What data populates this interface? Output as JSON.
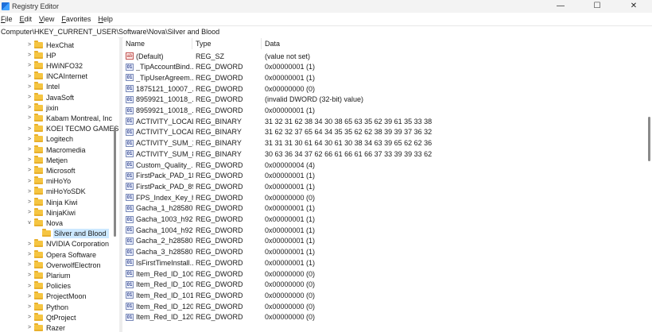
{
  "window": {
    "title": "Registry Editor",
    "controls": {
      "minimize": "—",
      "maximize": "☐",
      "close": "✕"
    }
  },
  "menu": [
    {
      "underline": "F",
      "rest": "ile"
    },
    {
      "underline": "E",
      "rest": "dit"
    },
    {
      "underline": "V",
      "rest": "iew"
    },
    {
      "underline": "F",
      "rest": "avorites"
    },
    {
      "underline": "H",
      "rest": "elp"
    }
  ],
  "address": "Computer\\HKEY_CURRENT_USER\\Software\\Nova\\Silver and Blood",
  "tree": {
    "items": [
      {
        "label": "HexChat",
        "expander": ">"
      },
      {
        "label": "HP",
        "expander": ">"
      },
      {
        "label": "HWiNFO32",
        "expander": ">"
      },
      {
        "label": "INCAInternet",
        "expander": ">"
      },
      {
        "label": "Intel",
        "expander": ">"
      },
      {
        "label": "JavaSoft",
        "expander": ">"
      },
      {
        "label": "jixin",
        "expander": ">"
      },
      {
        "label": "Kabam Montreal, Inc",
        "expander": ">"
      },
      {
        "label": "KOEI TECMO GAMES",
        "expander": ">"
      },
      {
        "label": "Logitech",
        "expander": ">"
      },
      {
        "label": "Macromedia",
        "expander": ">"
      },
      {
        "label": "Metjen",
        "expander": ">"
      },
      {
        "label": "Microsoft",
        "expander": ">"
      },
      {
        "label": "miHoYo",
        "expander": ">"
      },
      {
        "label": "miHoYoSDK",
        "expander": ">"
      },
      {
        "label": "Ninja Kiwi",
        "expander": ">"
      },
      {
        "label": "NinjaKiwi",
        "expander": ">"
      },
      {
        "label": "Nova",
        "expander": "v"
      },
      {
        "label": "Silver and Blood",
        "expander": ""
      },
      {
        "label": "NVIDIA Corporation",
        "expander": ">"
      },
      {
        "label": "Opera Software",
        "expander": ">"
      },
      {
        "label": "OverwolfElectron",
        "expander": ">"
      },
      {
        "label": "Plarium",
        "expander": ">"
      },
      {
        "label": "Policies",
        "expander": ">"
      },
      {
        "label": "ProjectMoon",
        "expander": ">"
      },
      {
        "label": "Python",
        "expander": ">"
      },
      {
        "label": "QtProject",
        "expander": ">"
      },
      {
        "label": "Razer",
        "expander": ">"
      }
    ]
  },
  "columns": {
    "name": "Name",
    "type": "Type",
    "data": "Data"
  },
  "rows": [
    {
      "icon": "ab",
      "name": "(Default)",
      "type": "REG_SZ",
      "data": "(value not set)"
    },
    {
      "icon": "01",
      "name": "_TipAccountBind...",
      "type": "REG_DWORD",
      "data": "0x00000001 (1)"
    },
    {
      "icon": "01",
      "name": "_TipUserAgreem...",
      "type": "REG_DWORD",
      "data": "0x00000001 (1)"
    },
    {
      "icon": "01",
      "name": "1875121_10007_...",
      "type": "REG_DWORD",
      "data": "0x00000000 (0)"
    },
    {
      "icon": "01",
      "name": "8959921_10018_...",
      "type": "REG_DWORD",
      "data": "(invalid DWORD (32-bit) value)"
    },
    {
      "icon": "01",
      "name": "8959921_10018_...",
      "type": "REG_DWORD",
      "data": "0x00000001 (1)"
    },
    {
      "icon": "01",
      "name": "ACTIVITY_LOCAL...",
      "type": "REG_BINARY",
      "data": "31 32 31 62 38 34 30 38 65 63 35 62 39 61 35 33 38..."
    },
    {
      "icon": "01",
      "name": "ACTIVITY_LOCAL...",
      "type": "REG_BINARY",
      "data": "31 62 32 37 65 64 34 35 35 62 62 38 39 39 37 36 32..."
    },
    {
      "icon": "01",
      "name": "ACTIVITY_SUM_1...",
      "type": "REG_BINARY",
      "data": "31 31 31 30 61 64 30 61 30 38 34 63 39 65 62 62 36..."
    },
    {
      "icon": "01",
      "name": "ACTIVITY_SUM_8...",
      "type": "REG_BINARY",
      "data": "30 63 36 34 37 62 66 61 66 61 66 37 33 39 39 33 62..."
    },
    {
      "icon": "01",
      "name": "Custom_Quality_...",
      "type": "REG_DWORD",
      "data": "0x00000004 (4)"
    },
    {
      "icon": "01",
      "name": "FirstPack_PAD_18...",
      "type": "REG_DWORD",
      "data": "0x00000001 (1)"
    },
    {
      "icon": "01",
      "name": "FirstPack_PAD_89...",
      "type": "REG_DWORD",
      "data": "0x00000001 (1)"
    },
    {
      "icon": "01",
      "name": "FPS_Index_Key_h...",
      "type": "REG_DWORD",
      "data": "0x00000000 (0)"
    },
    {
      "icon": "01",
      "name": "Gacha_1_h28580...",
      "type": "REG_DWORD",
      "data": "0x00000001 (1)"
    },
    {
      "icon": "01",
      "name": "Gacha_1003_h92...",
      "type": "REG_DWORD",
      "data": "0x00000001 (1)"
    },
    {
      "icon": "01",
      "name": "Gacha_1004_h92...",
      "type": "REG_DWORD",
      "data": "0x00000001 (1)"
    },
    {
      "icon": "01",
      "name": "Gacha_2_h28580...",
      "type": "REG_DWORD",
      "data": "0x00000001 (1)"
    },
    {
      "icon": "01",
      "name": "Gacha_3_h28580...",
      "type": "REG_DWORD",
      "data": "0x00000001 (1)"
    },
    {
      "icon": "01",
      "name": "IsFirstTimeInstall...",
      "type": "REG_DWORD",
      "data": "0x00000001 (1)"
    },
    {
      "icon": "01",
      "name": "Item_Red_ID_100...",
      "type": "REG_DWORD",
      "data": "0x00000000 (0)"
    },
    {
      "icon": "01",
      "name": "Item_Red_ID_100...",
      "type": "REG_DWORD",
      "data": "0x00000000 (0)"
    },
    {
      "icon": "01",
      "name": "Item_Red_ID_101...",
      "type": "REG_DWORD",
      "data": "0x00000000 (0)"
    },
    {
      "icon": "01",
      "name": "Item_Red_ID_120...",
      "type": "REG_DWORD",
      "data": "0x00000000 (0)"
    },
    {
      "icon": "01",
      "name": "Item_Red_ID_120...",
      "type": "REG_DWORD",
      "data": "0x00000000 (0)"
    }
  ]
}
